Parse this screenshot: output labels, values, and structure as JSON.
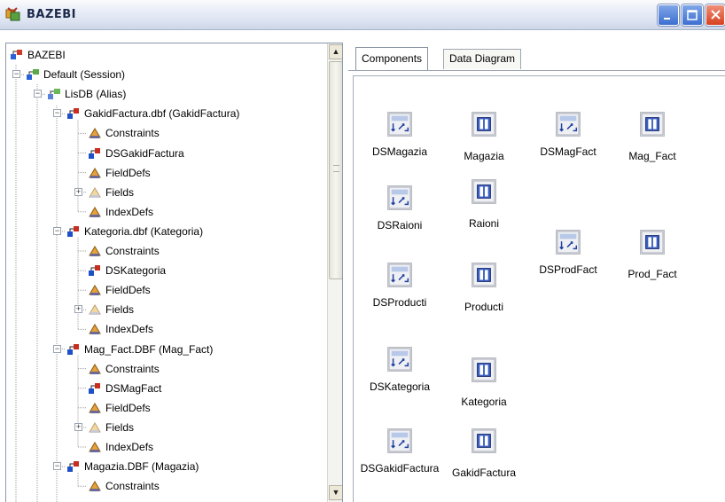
{
  "window": {
    "title": "BAZEBI"
  },
  "tree": {
    "nodes": [
      {
        "label": "BAZEBI",
        "icon": "database-icon"
      },
      {
        "label": "Default (Session)",
        "icon": "session-icon"
      },
      {
        "label": "LisDB (Alias)",
        "icon": "alias-icon"
      },
      {
        "label": "GakidFactura.dbf (GakidFactura)",
        "icon": "table-icon"
      },
      {
        "label": "Constraints",
        "icon": "constraints-icon"
      },
      {
        "label": "DSGakidFactura",
        "icon": "datasource-icon"
      },
      {
        "label": "FieldDefs",
        "icon": "fielddefs-icon"
      },
      {
        "label": "Fields",
        "icon": "fields-icon"
      },
      {
        "label": "IndexDefs",
        "icon": "indexdefs-icon"
      },
      {
        "label": "Kategoria.dbf (Kategoria)",
        "icon": "table-icon"
      },
      {
        "label": "Constraints",
        "icon": "constraints-icon"
      },
      {
        "label": "DSKategoria",
        "icon": "datasource-icon"
      },
      {
        "label": "FieldDefs",
        "icon": "fielddefs-icon"
      },
      {
        "label": "Fields",
        "icon": "fields-icon"
      },
      {
        "label": "IndexDefs",
        "icon": "indexdefs-icon"
      },
      {
        "label": "Mag_Fact.DBF (Mag_Fact)",
        "icon": "table-icon"
      },
      {
        "label": "Constraints",
        "icon": "constraints-icon"
      },
      {
        "label": "DSMagFact",
        "icon": "datasource-icon"
      },
      {
        "label": "FieldDefs",
        "icon": "fielddefs-icon"
      },
      {
        "label": "Fields",
        "icon": "fields-icon"
      },
      {
        "label": "IndexDefs",
        "icon": "indexdefs-icon"
      },
      {
        "label": "Magazia.DBF (Magazia)",
        "icon": "table-icon"
      },
      {
        "label": "Constraints",
        "icon": "constraints-icon"
      }
    ]
  },
  "tabs": {
    "components": "Components",
    "data_diagram": "Data Diagram"
  },
  "components": [
    {
      "label": "DSMagazia",
      "kind": "datasource"
    },
    {
      "label": "Magazia",
      "kind": "table"
    },
    {
      "label": "DSMagFact",
      "kind": "datasource"
    },
    {
      "label": "Mag_Fact",
      "kind": "table"
    },
    {
      "label": "DSRaioni",
      "kind": "datasource"
    },
    {
      "label": "Raioni",
      "kind": "table"
    },
    {
      "label": "DSProdFact",
      "kind": "datasource"
    },
    {
      "label": "Prod_Fact",
      "kind": "table"
    },
    {
      "label": "DSProducti",
      "kind": "datasource"
    },
    {
      "label": "Producti",
      "kind": "table"
    },
    {
      "label": "DSKategoria",
      "kind": "datasource"
    },
    {
      "label": "Kategoria",
      "kind": "table"
    },
    {
      "label": "DSGakidFactura",
      "kind": "datasource"
    },
    {
      "label": "GakidFactura",
      "kind": "table"
    }
  ],
  "colors": {
    "title_bar": "#dde4f1",
    "close_button": "#d6401e",
    "accent_blue": "#3d6fd0"
  }
}
